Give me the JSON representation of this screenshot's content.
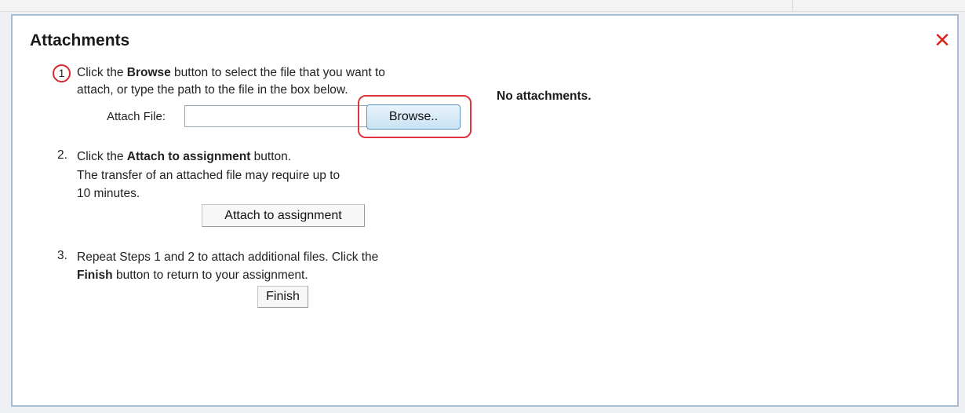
{
  "dialog": {
    "title": "Attachments",
    "close_icon": "close-x-icon",
    "no_attachments_text": "No attachments."
  },
  "step1": {
    "number": "1",
    "line1_a": "Click the ",
    "line1_b": "Browse",
    "line1_c": " button to select the file that you want to",
    "line2": "attach, or type the path to the file in the box below.",
    "attach_label": "Attach File:",
    "file_value": "",
    "browse_label": "Browse.."
  },
  "step2": {
    "number": "2.",
    "line1_a": "Click the ",
    "line1_b": "Attach to assignment",
    "line1_c": " button.",
    "line2": "The transfer of an attached file may require up to",
    "line3": "10 minutes.",
    "button_label": "Attach to assignment"
  },
  "step3": {
    "number": "3.",
    "line1": "Repeat Steps 1 and 2 to attach additional files. Click the",
    "line2_a": "Finish",
    "line2_b": " button to return to your assignment.",
    "button_label": "Finish"
  },
  "colors": {
    "highlight_red": "#e0333d",
    "close_red": "#d9261c",
    "dialog_border": "#a9bcd6"
  }
}
